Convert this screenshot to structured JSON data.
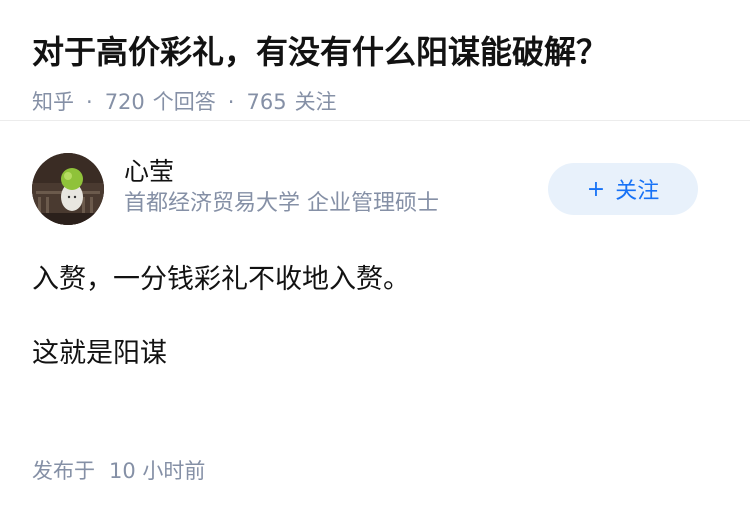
{
  "question": {
    "title": "对于高价彩礼，有没有什么阳谋能破解？",
    "source": "知乎",
    "separator": "·",
    "answer_count": "720",
    "answer_label": "个回答",
    "follower_count": "765",
    "follower_label": "关注"
  },
  "author": {
    "name": "心莹",
    "headline": "首都经济贸易大学 企业管理硕士",
    "avatar_icon": "avatar-photo",
    "follow_plus": "+",
    "follow_label": "关注"
  },
  "answer": {
    "paragraphs": [
      "入赘，一分钱彩礼不收地入赘。",
      "这就是阳谋"
    ],
    "time_label": "发布于",
    "time_value": "10 小时前"
  },
  "colors": {
    "meta_gray": "#8590a6",
    "follow_bg": "#e8f1fb",
    "follow_text": "#1772f6"
  }
}
